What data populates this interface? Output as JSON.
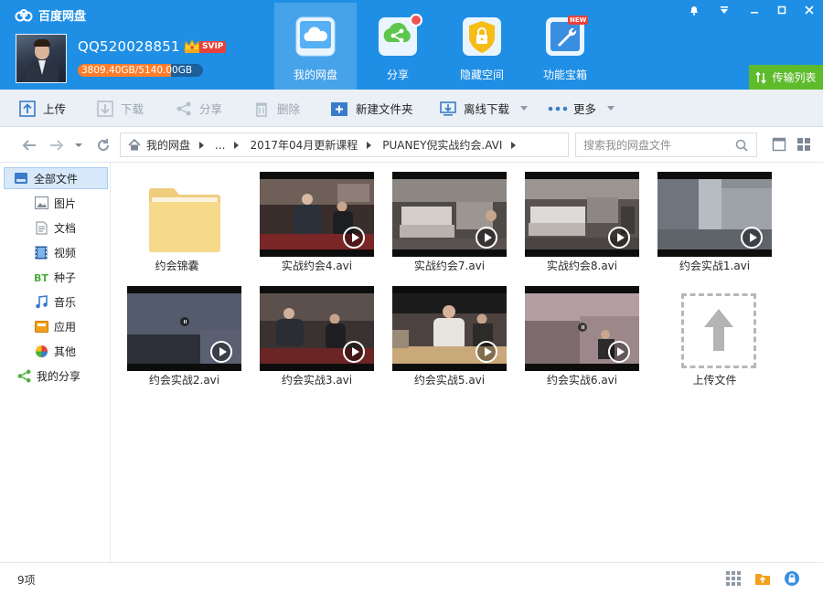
{
  "header": {
    "app_title": "百度网盘",
    "username": "QQ520028851",
    "vip_tag": "SVIP",
    "quota_text": "3809.40GB/5140.00GB",
    "quota_used_fraction": 0.741,
    "transfer_label": "传输列表"
  },
  "nav": [
    {
      "label": "我的网盘",
      "icon": "cloud-icon",
      "active": true
    },
    {
      "label": "分享",
      "icon": "share-icon",
      "badge": "dot"
    },
    {
      "label": "隐藏空间",
      "icon": "lock-icon"
    },
    {
      "label": "功能宝箱",
      "icon": "wrench-icon",
      "badge": "NEW"
    }
  ],
  "toolbar": {
    "upload": "上传",
    "download": "下载",
    "share": "分享",
    "delete": "删除",
    "new_folder": "新建文件夹",
    "offline_download": "离线下载",
    "more": "更多"
  },
  "breadcrumb": {
    "root": "我的网盘",
    "ellipsis": "...",
    "level1": "2017年04月更新课程",
    "level2": "PUANEY倪实战约会.AVI"
  },
  "search": {
    "placeholder": "搜索我的网盘文件"
  },
  "sidebar": {
    "all_files": "全部文件",
    "images": "图片",
    "docs": "文档",
    "videos": "视频",
    "torrents": "种子",
    "music": "音乐",
    "apps": "应用",
    "other": "其他",
    "my_share": "我的分享"
  },
  "files": {
    "folder": "约会锦囊",
    "v1": "实战约会4.avi",
    "v2": "实战约会7.avi",
    "v3": "实战约会8.avi",
    "v4": "约会实战1.avi",
    "v5": "约会实战2.avi",
    "v6": "约会实战3.avi",
    "v7": "约会实战5.avi",
    "v8": "约会实战6.avi",
    "upload": "上传文件"
  },
  "status": {
    "count": "9项"
  },
  "colors": {
    "header_bg": "#1f8fe5",
    "transfer_green": "#5dbb2c",
    "quota_orange": "#ff7d2a",
    "svip_red": "#e8413b"
  }
}
